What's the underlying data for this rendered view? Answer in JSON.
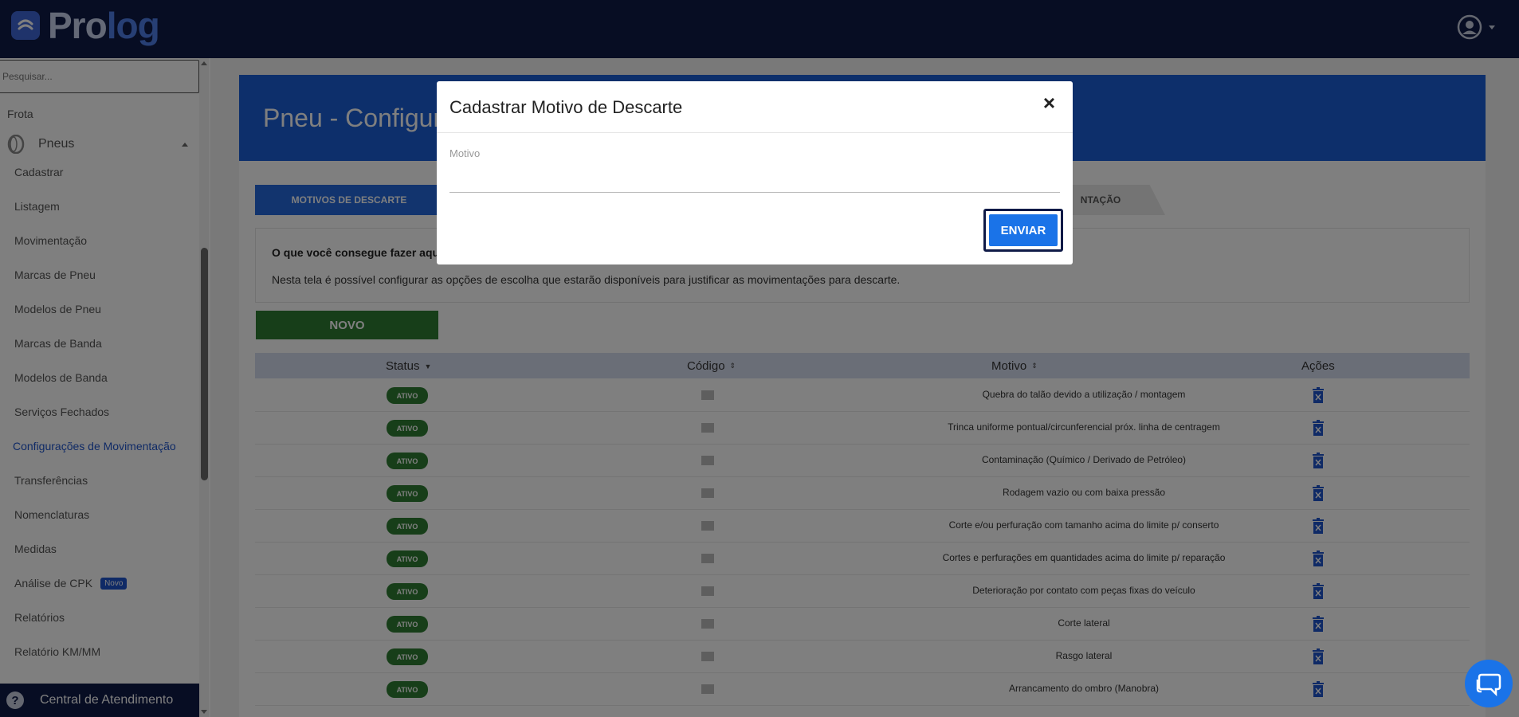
{
  "topbar": {
    "logo_text_a": "Pro",
    "logo_text_b": "log",
    "colors": {
      "bg": "#0f1a47",
      "logo_accent": "#4f7ee8"
    }
  },
  "sidebar": {
    "search_placeholder": "Pesquisar...",
    "section": "Frota",
    "group_label": "Pneus",
    "items": [
      "Cadastrar",
      "Listagem",
      "Movimentação",
      "Marcas de Pneu",
      "Modelos de Pneu",
      "Marcas de Banda",
      "Modelos de Banda",
      "Serviços Fechados",
      "Configurações de Movimentação",
      "Transferências",
      "Nomenclaturas",
      "Medidas",
      "Análise de CPK",
      "Relatórios",
      "Relatório KM/MM"
    ],
    "active_item": "Configurações de Movimentação",
    "novo_badge": "Novo",
    "central_label": "Central de Atendimento"
  },
  "main": {
    "title": "Pneu - Configura",
    "tabs": [
      {
        "label": "MOTIVOS DE DESCARTE",
        "active": true
      },
      {
        "label": "NTAÇÃO",
        "active": false
      }
    ],
    "info_title": "O que você consegue fazer aqui",
    "info_text": "Nesta tela é possível configurar as opções de escolha que estarão disponíveis para justificar as movimentações para descarte.",
    "novo_button": "NOVO",
    "table": {
      "headers": [
        "Status",
        "Código",
        "Motivo",
        "Ações"
      ],
      "rows": [
        {
          "status": "ATIVO",
          "motivo": "Quebra do talão devido a utilização / montagem"
        },
        {
          "status": "ATIVO",
          "motivo": "Trinca uniforme pontual/circunferencial próx. linha de centragem"
        },
        {
          "status": "ATIVO",
          "motivo": "Contaminação (Químico / Derivado de Petróleo)"
        },
        {
          "status": "ATIVO",
          "motivo": "Rodagem vazio ou com baixa pressão"
        },
        {
          "status": "ATIVO",
          "motivo": "Corte e/ou perfuração com tamanho acima do limite p/ conserto"
        },
        {
          "status": "ATIVO",
          "motivo": "Cortes e perfurações em quantidades acima do limite p/ reparação"
        },
        {
          "status": "ATIVO",
          "motivo": "Deterioração por contato com peças fixas do veículo"
        },
        {
          "status": "ATIVO",
          "motivo": "Corte lateral"
        },
        {
          "status": "ATIVO",
          "motivo": "Rasgo lateral"
        },
        {
          "status": "ATIVO",
          "motivo": "Arrancamento do ombro (Manobra)"
        }
      ]
    },
    "colors": {
      "header": "#1b5fd6",
      "status": "#2e7d32",
      "novo": "#2e7d32"
    }
  },
  "modal": {
    "title": "Cadastrar Motivo de Descarte",
    "close_glyph": "×",
    "field_label": "Motivo",
    "field_value": "",
    "submit_label": "ENVIAR",
    "colors": {
      "submit": "#1a73e8"
    }
  },
  "icons": [
    "user-icon",
    "tire-icon",
    "help-icon",
    "trash-icon",
    "chat-icon",
    "close-icon"
  ]
}
